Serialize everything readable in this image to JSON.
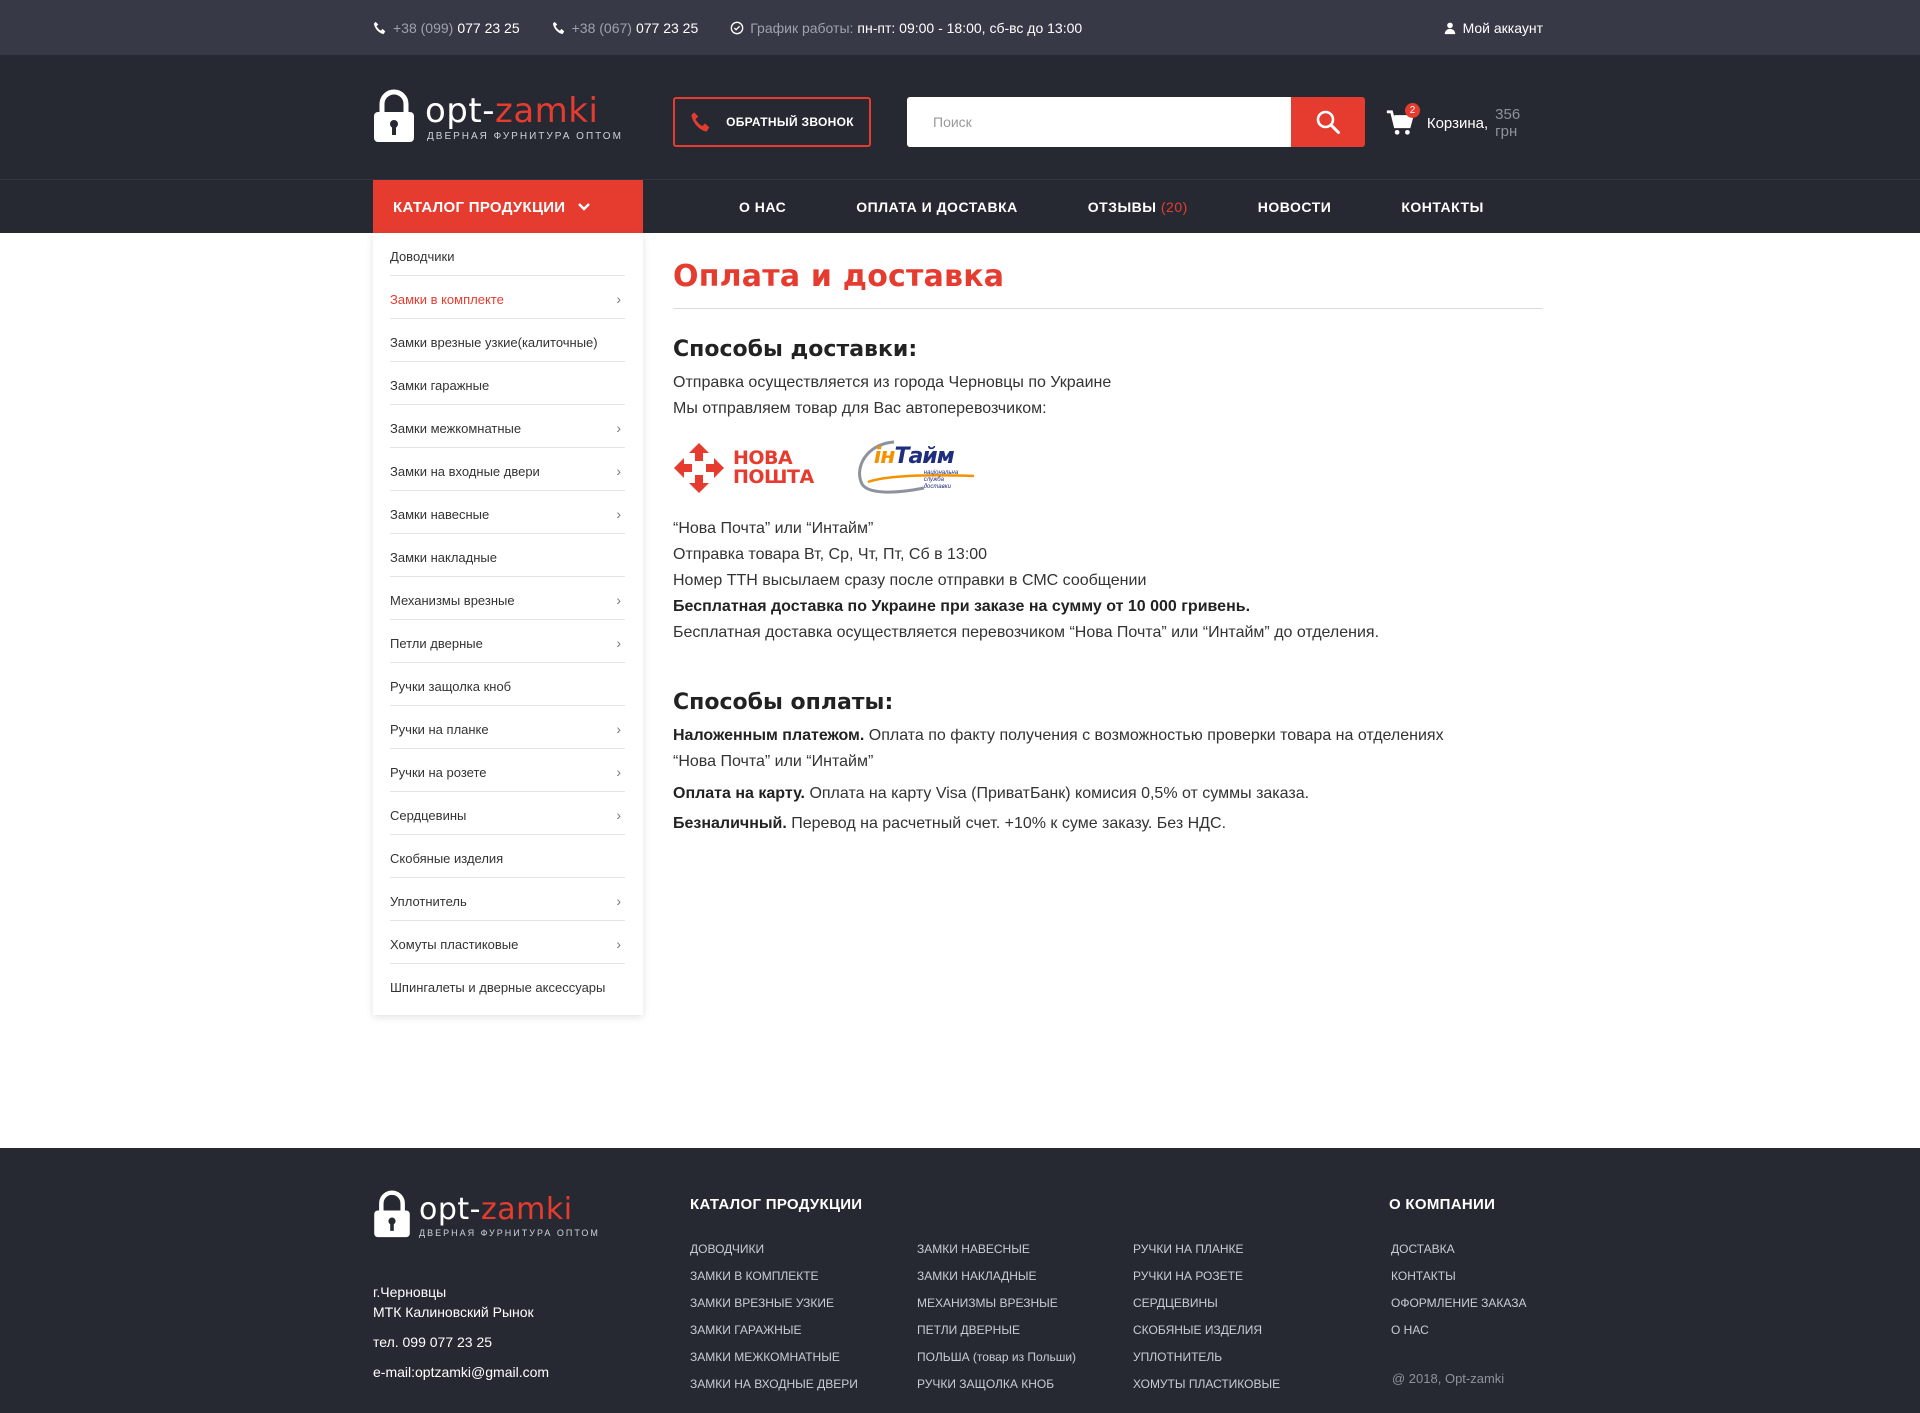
{
  "topbar": {
    "phone1_prefix": "+38 (099)",
    "phone1_number": "077 23 25",
    "phone2_prefix": "+38 (067)",
    "phone2_number": "077 23 25",
    "schedule_label": "График работы:",
    "schedule_value": "пн-пт: 09:00 - 18:00, сб-вс до 13:00",
    "account": "Мой аккаунт"
  },
  "header": {
    "logo_part1": "opt-",
    "logo_part2": "zamki",
    "logo_sub": "ДВЕРНАЯ ФУРНИТУРА ОПТОМ",
    "callback": "ОБРАТНЫЙ ЗВОНОК",
    "search_placeholder": "Поиск",
    "cart_count": "2",
    "cart_label": "Корзина,",
    "cart_sum": "356 грн"
  },
  "nav": {
    "catalog": "КАТАЛОГ ПРОДУКЦИИ",
    "links": [
      {
        "label": "О НАС"
      },
      {
        "label": "ОПЛАТА И ДОСТАВКА"
      },
      {
        "label": "ОТЗЫВЫ",
        "count": "(20)"
      },
      {
        "label": "НОВОСТИ"
      },
      {
        "label": "КОНТАКТЫ"
      }
    ]
  },
  "sidebar": {
    "items": [
      {
        "label": "Доводчики"
      },
      {
        "label": "Замки в комплекте"
      },
      {
        "label": "Замки врезные узкие(калиточные)"
      },
      {
        "label": "Замки гаражные"
      },
      {
        "label": "Замки межкомнатные"
      },
      {
        "label": "Замки на входные двери"
      },
      {
        "label": "Замки навесные"
      },
      {
        "label": "Замки накладные"
      },
      {
        "label": "Механизмы врезные"
      },
      {
        "label": "Петли дверные"
      },
      {
        "label": "Ручки защолка кноб"
      },
      {
        "label": "Ручки на планке"
      },
      {
        "label": "Ручки на розете"
      },
      {
        "label": "Сердцевины"
      },
      {
        "label": "Скобяные изделия"
      },
      {
        "label": "Уплотнитель"
      },
      {
        "label": "Хомуты пластиковые"
      },
      {
        "label": "Шпингалеты и дверные аксессуары"
      }
    ]
  },
  "content": {
    "title": "Оплата и доставка",
    "delivery_heading": "Способы доставки:",
    "delivery_intro_1": "Отправка осуществляется из города Черновцы по Украине",
    "delivery_intro_2": "Мы отправляем товар для Вас автоперевозчиком:",
    "novaposhta_line1": "НОВА",
    "novaposhta_line2": "ПОШТА",
    "intime_part1": "ін",
    "intime_part2": "Тайм",
    "intime_sub": "національна служба доставки",
    "delivery_1": "“Нова Почта”  или “Интайм”",
    "delivery_2": "Отправка товара Вт, Ср, Чт, Пт, Сб в 13:00",
    "delivery_3": "Номер ТТН высылаем сразу после отправки в СМС сообщении",
    "delivery_4": "Бесплатная доставка по Украине при заказе на сумму от 10 000 гривень.",
    "delivery_5": "Бесплатная доставка осуществляется перевозчиком “Нова Почта”  или “Интайм” до отделения.",
    "payment_heading": "Способы оплаты:",
    "pay_1_bold": "Наложенным платежом.",
    "pay_1_text": " Оплата по факту получения с возможностью проверки товара на отделениях",
    "pay_1_text2": "“Нова Почта” или “Интайм”",
    "pay_2_bold": "Оплата на карту.",
    "pay_2_text": " Оплата на карту Visa (ПриватБанк) комисия 0,5% от суммы заказа.",
    "pay_3_bold": "Безналичный.",
    "pay_3_text": " Перевод на расчетный счет. +10% к суме заказу. Без НДС."
  },
  "footer": {
    "address_1": "г.Черновцы",
    "address_2": "МТК Калиновский Рынок",
    "phone": "тел. 099 077 23 25",
    "email": "e-mail:optzamki@gmail.com",
    "catalog_heading": "КАТАЛОГ ПРОДУКЦИИ",
    "col1": [
      "ДОВОДЧИКИ",
      "ЗАМКИ В КОМПЛЕКТЕ",
      "ЗАМКИ ВРЕЗНЫЕ УЗКИЕ",
      "ЗАМКИ ГАРАЖНЫЕ",
      "ЗАМКИ МЕЖКОМНАТНЫЕ",
      "ЗАМКИ НА ВХОДНЫЕ ДВЕРИ"
    ],
    "col2": [
      "ЗАМКИ НАВЕСНЫЕ",
      "ЗАМКИ НАКЛАДНЫЕ",
      "МЕХАНИЗМЫ ВРЕЗНЫЕ",
      "ПЕТЛИ ДВЕРНЫЕ",
      "ПОЛЬША (товар из Польши)",
      "РУЧКИ ЗАЩОЛКА КНОБ"
    ],
    "col3": [
      "РУЧКИ НА ПЛАНКЕ",
      "РУЧКИ НА РОЗЕТЕ",
      "СЕРДЦЕВИНЫ",
      "СКОБЯНЫЕ ИЗДЕЛИЯ",
      "УПЛОТНИТЕЛЬ",
      "ХОМУТЫ ПЛАСТИКОВЫЕ"
    ],
    "company_heading": "О КОМПАНИИ",
    "company": [
      "ДОСТАВКА",
      "КОНТАКТЫ",
      "ОФОРМЛЕНИЕ ЗАКАЗА",
      "О НАС"
    ],
    "copyright": "@ 2018, Opt-zamki"
  },
  "colors": {
    "accent": "#e63c30",
    "dark": "#262932",
    "topbar": "#373a46"
  }
}
